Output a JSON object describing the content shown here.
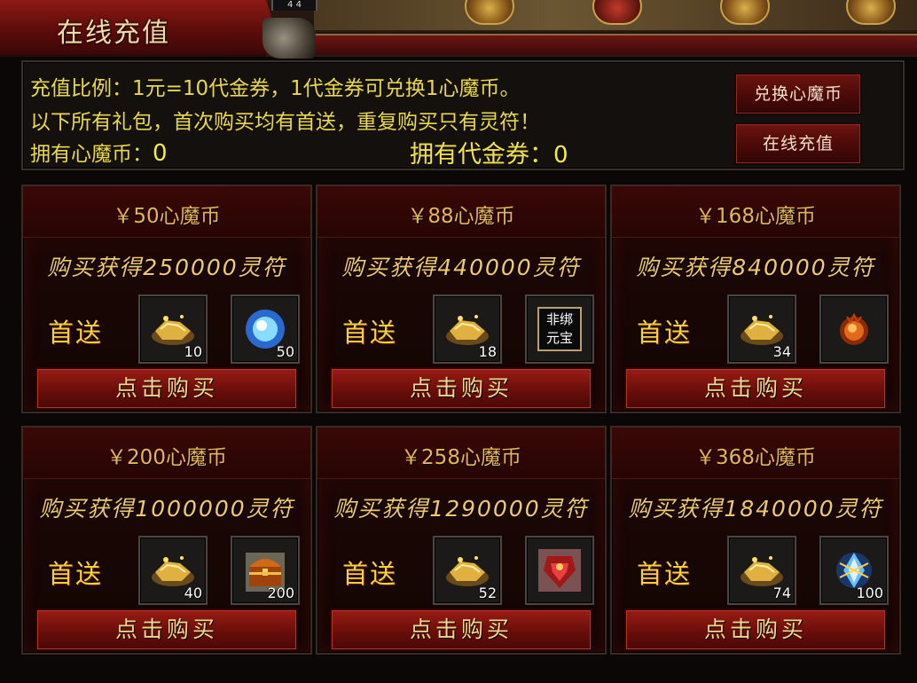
{
  "window": {
    "title": "在线充值",
    "pin_label": "4 4"
  },
  "info": {
    "line1": "充值比例：1元=10代金券，1代金券可兑换1心魔币。",
    "line2": "以下所有礼包，首次购买均有首送，重复购买只有灵符！",
    "coins_label": "拥有心魔币：",
    "coins_value": "0",
    "voucher_label": "拥有代金券：",
    "voucher_value": "0"
  },
  "buttons": {
    "exchange": "兑换心魔币",
    "recharge": "在线充值"
  },
  "packages": [
    {
      "price": "￥50心魔币",
      "gain": "购买获得250000灵符",
      "first_label": "首送",
      "item_a": {
        "icon": "gold-ingot-pile-icon",
        "count": "10"
      },
      "item_b": {
        "icon": "blue-orb-icon",
        "count": "50"
      },
      "buy_label": "点击购买"
    },
    {
      "price": "￥88心魔币",
      "gain": "购买获得440000灵符",
      "first_label": "首送",
      "item_a": {
        "icon": "gold-ingot-pile-icon",
        "count": "18"
      },
      "item_b": {
        "icon": "unbound-ingot-icon",
        "text": "非绑\n元宝",
        "count": ""
      },
      "buy_label": "点击购买"
    },
    {
      "price": "￥168心魔币",
      "gain": "购买获得840000灵符",
      "first_label": "首送",
      "item_a": {
        "icon": "gold-ingot-pile-icon",
        "count": "34"
      },
      "item_b": {
        "icon": "fire-orb-icon",
        "count": ""
      },
      "buy_label": "点击购买"
    },
    {
      "price": "￥200心魔币",
      "gain": "购买获得1000000灵符",
      "first_label": "首送",
      "item_a": {
        "icon": "gold-ingot-pile-icon",
        "count": "40"
      },
      "item_b": {
        "icon": "treasure-chest-icon",
        "count": "200"
      },
      "buy_label": "点击购买"
    },
    {
      "price": "￥258心魔币",
      "gain": "购买获得1290000灵符",
      "first_label": "首送",
      "item_a": {
        "icon": "gold-ingot-pile-icon",
        "count": "52"
      },
      "item_b": {
        "icon": "red-mask-icon",
        "count": ""
      },
      "buy_label": "点击购买"
    },
    {
      "price": "￥368心魔币",
      "gain": "购买获得1840000灵符",
      "first_label": "首送",
      "item_a": {
        "icon": "gold-ingot-pile-icon",
        "count": "74"
      },
      "item_b": {
        "icon": "blue-crystal-icon",
        "count": "100"
      },
      "buy_label": "点击购买"
    }
  ],
  "colors": {
    "accent_yellow": "#e8d84a",
    "price_gold": "#e8b458",
    "button_red": "#9a1c14",
    "panel_bg": "#14100d"
  }
}
